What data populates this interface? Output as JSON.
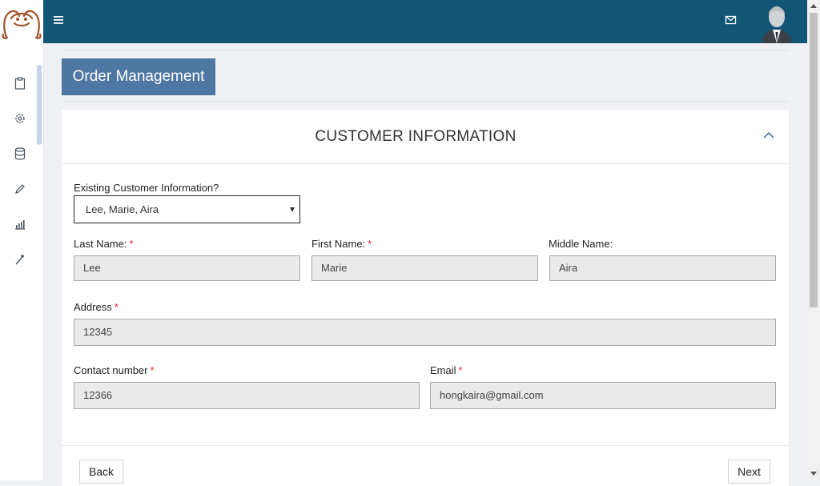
{
  "sidebar": {
    "logo": "monkey-logo",
    "icons": [
      "clipboard-icon",
      "gear-icon",
      "database-icon",
      "pencil-icon",
      "bar-chart-icon",
      "magic-wand-icon"
    ]
  },
  "topbar": {
    "menu_icon": "hamburger-icon",
    "mail_icon": "mail-icon",
    "avatar_icon": "user-avatar"
  },
  "page": {
    "title": "Order Management"
  },
  "section": {
    "title": "CUSTOMER INFORMATION"
  },
  "form": {
    "existing_label": "Existing Customer Information?",
    "existing_value": "Lee, Marie, Aira",
    "required_mark": "*",
    "last_name_label": "Last Name:",
    "last_name_value": "Lee",
    "first_name_label": "First Name:",
    "first_name_value": "Marie",
    "middle_name_label": "Middle Name:",
    "middle_name_value": "Aira",
    "address_label": "Address",
    "address_value": "12345",
    "contact_label": "Contact number",
    "contact_value": "12366",
    "email_label": "Email",
    "email_value": "hongkaira@gmail.com"
  },
  "buttons": {
    "back": "Back",
    "next": "Next"
  },
  "colors": {
    "topbar": "#135575",
    "title_badge": "#4f77a3",
    "required": "#e0262b"
  }
}
